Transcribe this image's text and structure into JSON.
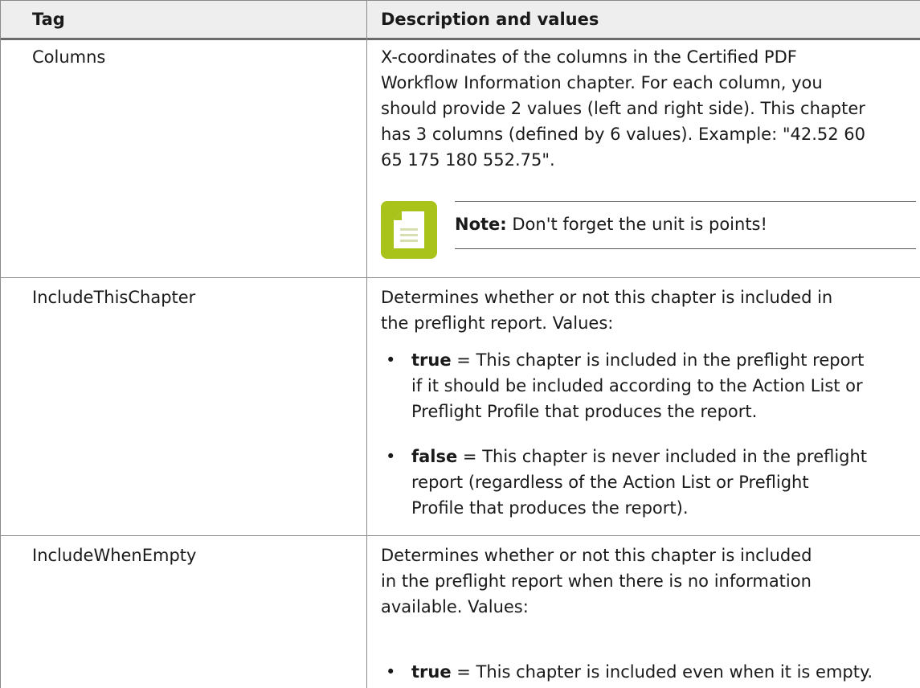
{
  "header": {
    "col1": "Tag",
    "col2": "Description and values"
  },
  "rows": [
    {
      "tag": "Columns",
      "desc_lines": [
        "X-coordinates of the columns in the Certified PDF",
        "Workflow Information chapter. For each column, you",
        "should provide 2 values (left and right side). This chapter",
        "has 3 columns (defined by 6 values). Example: \"42.52 60",
        "65 175 180 552.75\"."
      ],
      "note": {
        "label": "Note:",
        "text": " Don't forget the unit is points!",
        "icon": "document-note-icon",
        "icon_color": "#a9c31b"
      }
    },
    {
      "tag": "IncludeThisChapter",
      "desc_lines": [
        "Determines whether or not this chapter is included in",
        "the preflight report. Values:"
      ],
      "bullets": [
        {
          "term": "true",
          "lines": [
            " = This chapter is included in the preflight report",
            "if it should be included according to the Action List or",
            "Preflight Profile that produces the report."
          ]
        },
        {
          "term": "false",
          "lines": [
            " = This chapter is never included in the preflight",
            "report (regardless of the Action List or Preflight",
            "Profile that produces the report)."
          ]
        }
      ]
    },
    {
      "tag": "IncludeWhenEmpty",
      "desc_lines": [
        "Determines whether or not this chapter is included",
        "in the preflight report when there is no information",
        "available. Values:"
      ],
      "bullets": [
        {
          "term": "true",
          "lines": [
            " = This chapter is included even when it is empty."
          ]
        }
      ]
    }
  ],
  "colors": {
    "header_bg": "#eeeeee",
    "border": "#8a8a8a",
    "note_icon": "#a9c31b"
  }
}
